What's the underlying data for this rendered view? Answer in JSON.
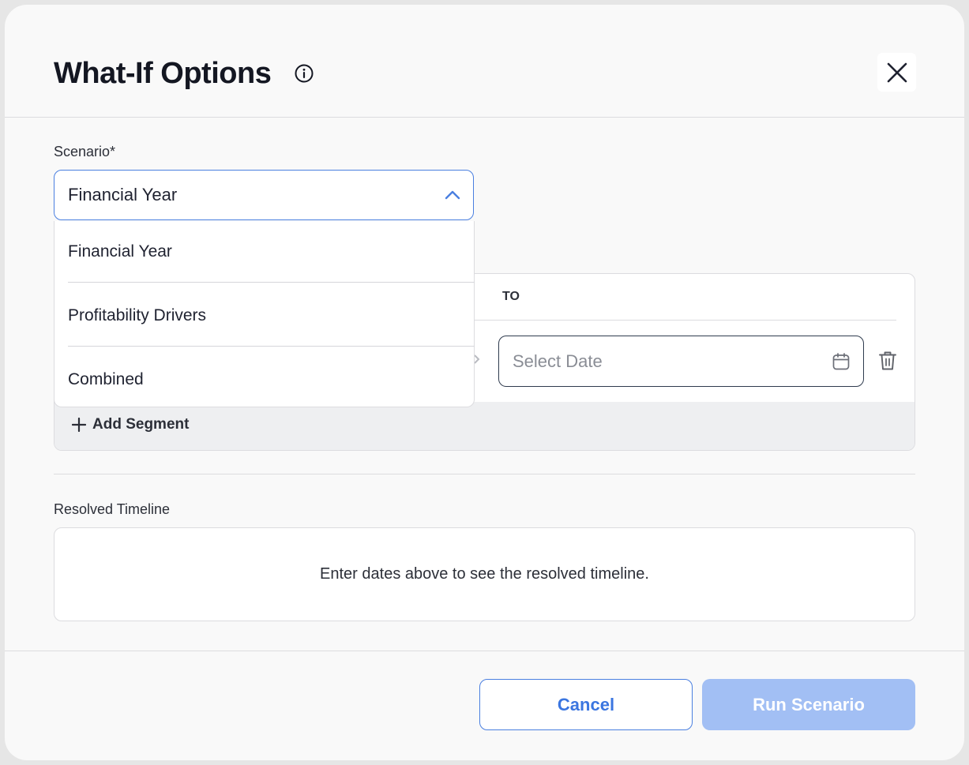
{
  "dialog": {
    "title": "What-If Options",
    "info_icon": "info-icon",
    "close_icon": "close-icon"
  },
  "scenario": {
    "label": "Scenario*",
    "selected": "Financial Year",
    "options": [
      "Financial Year",
      "Profitability Drivers",
      "Combined"
    ]
  },
  "segments": {
    "to_header": "TO",
    "date_placeholder": "Select Date",
    "add_segment_label": "Add Segment"
  },
  "timeline": {
    "label": "Resolved Timeline",
    "empty_message": "Enter dates above to see the resolved timeline."
  },
  "footer": {
    "cancel_label": "Cancel",
    "run_label": "Run Scenario"
  },
  "colors": {
    "accent": "#4a7fe0",
    "run_disabled": "#a2bff4",
    "text": "#141722"
  }
}
